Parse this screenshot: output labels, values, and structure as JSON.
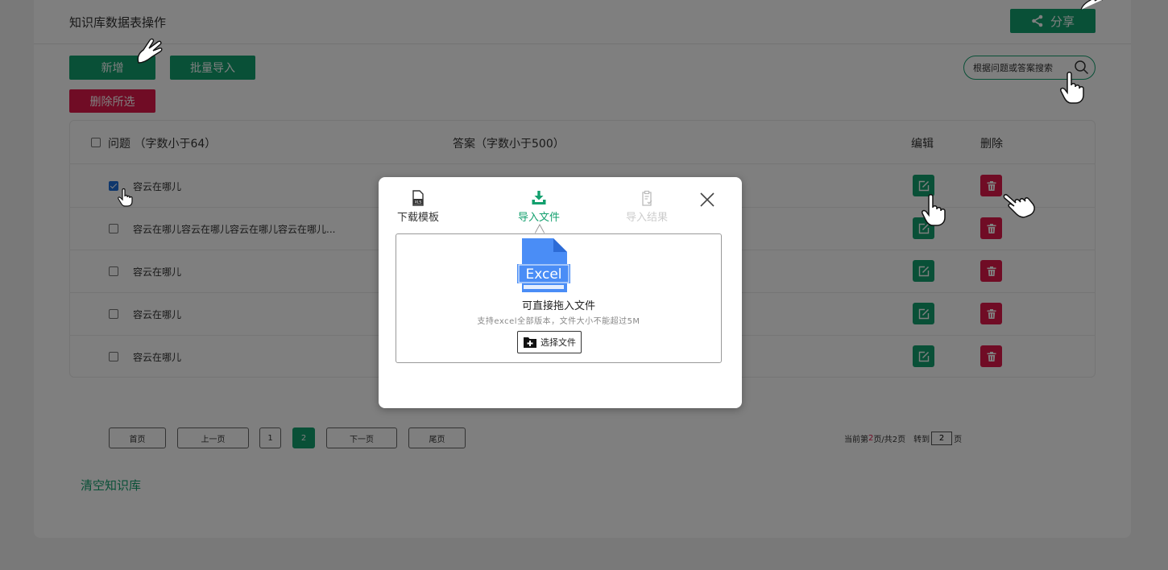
{
  "header": {
    "title": "知识库数据表操作",
    "share_label": "分享"
  },
  "toolbar": {
    "add_label": "新增",
    "import_label": "批量导入",
    "delete_selected_label": "删除所选"
  },
  "search": {
    "placeholder": "根据问题或答案搜索"
  },
  "table": {
    "columns": {
      "question": "问题 （字数小于64）",
      "answer": "答案（字数小于500）",
      "edit": "编辑",
      "delete": "删除"
    },
    "rows": [
      {
        "question": "容云在哪儿",
        "checked": true
      },
      {
        "question": "容云在哪儿容云在哪儿容云在哪儿容云在哪儿...",
        "checked": false
      },
      {
        "question": "容云在哪儿",
        "checked": false
      },
      {
        "question": "容云在哪儿",
        "checked": false
      },
      {
        "question": "容云在哪儿",
        "checked": false
      }
    ]
  },
  "pagination": {
    "first": "首页",
    "prev": "上一页",
    "pages": [
      "1",
      "2"
    ],
    "current_page": "2",
    "next": "下一页",
    "last": "尾页",
    "info_prefix": "当前第",
    "info_current": "2",
    "info_suffix": "页/共2页",
    "goto_label": "转到",
    "goto_value": "2",
    "goto_unit": "页"
  },
  "clear_label": "清空知识库",
  "modal": {
    "steps": {
      "download": "下载模板",
      "import": "导入文件",
      "result": "导入结果"
    },
    "active_step": "import",
    "excel_label": "Excel",
    "drop_title": "可直接拖入文件",
    "drop_subtitle": "支持excel全部版本，文件大小不能超过5M",
    "choose_label": "选择文件"
  },
  "colors": {
    "primary": "#13a06e",
    "danger": "#e0194a",
    "excel_blue": "#4a8df6"
  }
}
